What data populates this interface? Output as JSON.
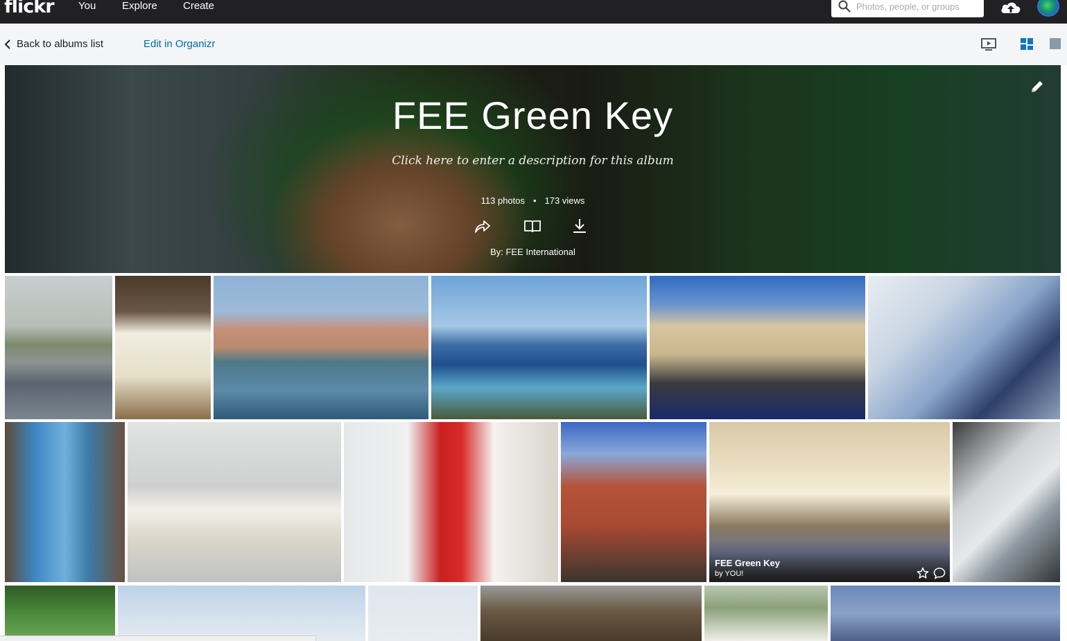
{
  "topnav": {
    "logo": "flickr",
    "links": [
      "You",
      "Explore",
      "Create"
    ],
    "search_placeholder": "Photos, people, or groups"
  },
  "subnav": {
    "back_label": "Back to albums list",
    "organizr_label": "Edit in Organizr"
  },
  "album": {
    "title": "FEE Green Key",
    "description_prompt": "Click here to enter a description for this album",
    "photos_count": "113 photos",
    "views_count": "173 views",
    "separator": "•",
    "owner": "By: FEE International"
  },
  "hover_photo": {
    "title": "FEE Green Key",
    "byline": "by YOU!"
  },
  "icons": {
    "search": "search-icon",
    "upload": "cloud-upload-icon",
    "slideshow": "slideshow-icon",
    "grid": "grid-view-icon",
    "single": "single-view-icon",
    "edit": "pencil-icon",
    "share": "share-icon",
    "book": "book-icon",
    "download": "download-icon",
    "favorite": "star-icon",
    "comment": "comment-icon"
  },
  "colors": {
    "topbar": "#212124",
    "subnav_bg": "#f3f5f6",
    "link_blue": "#006dac",
    "grid_icon_blue": "#0f76c0"
  }
}
